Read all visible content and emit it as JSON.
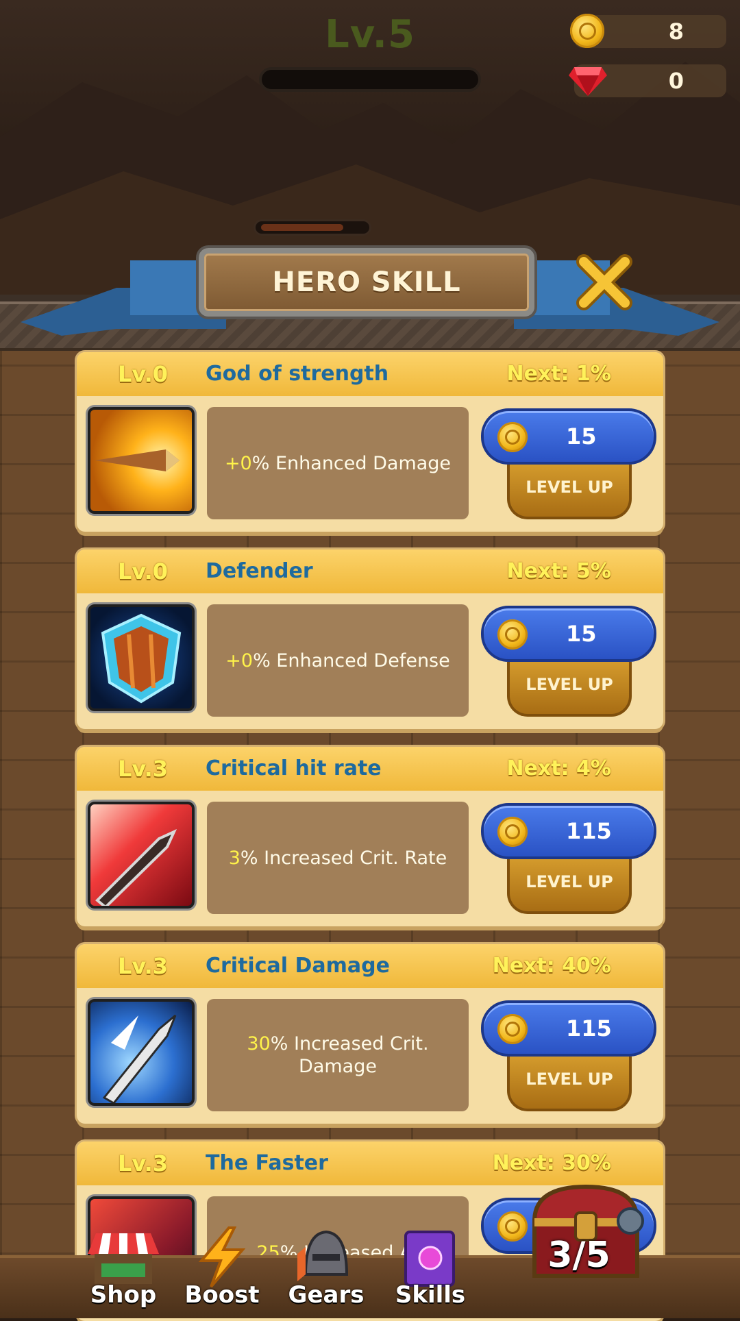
{
  "hud": {
    "level": "Lv.5",
    "coins": "8",
    "gems": "0",
    "coin_icon": "coin-icon",
    "gem_icon": "ruby-gem-icon"
  },
  "panel": {
    "title": "HERO SKILL",
    "close_icon": "close-x-icon"
  },
  "skills": [
    {
      "level": "Lv.0",
      "name": "God of strength",
      "next": "Next: 1%",
      "desc_value": "+0",
      "desc_text": "% Enhanced Damage",
      "cost": "15",
      "button": "LEVEL UP",
      "icon": "strength-blade-icon"
    },
    {
      "level": "Lv.0",
      "name": "Defender",
      "next": "Next: 5%",
      "desc_value": "+0",
      "desc_text": "% Enhanced Defense",
      "cost": "15",
      "button": "LEVEL UP",
      "icon": "shield-icon"
    },
    {
      "level": "Lv.3",
      "name": "Critical hit rate",
      "next": "Next: 4%",
      "desc_value": "3",
      "desc_text": "% Increased Crit. Rate",
      "cost": "115",
      "button": "LEVEL UP",
      "icon": "crit-sword-icon"
    },
    {
      "level": "Lv.3",
      "name": "Critical Damage",
      "next": "Next: 40%",
      "desc_value": "30",
      "desc_text": "% Increased Crit. Damage",
      "cost": "115",
      "button": "LEVEL UP",
      "icon": "crit-damage-icon"
    },
    {
      "level": "Lv.3",
      "name": "The Faster",
      "next": "Next: 30%",
      "desc_value": "25",
      "desc_text": "% Increased At",
      "icon": "faster-icon"
    }
  ],
  "nav": {
    "shop": "Shop",
    "boost": "Boost",
    "gears": "Gears",
    "skills": "Skills",
    "chest_count": "3/5"
  },
  "colors": {
    "card_header": "#f0b83a",
    "level_text": "#fff25a",
    "name_text": "#1e6a9e",
    "cost_button": "#2a52c4",
    "levelup_button": "#a86d14"
  }
}
